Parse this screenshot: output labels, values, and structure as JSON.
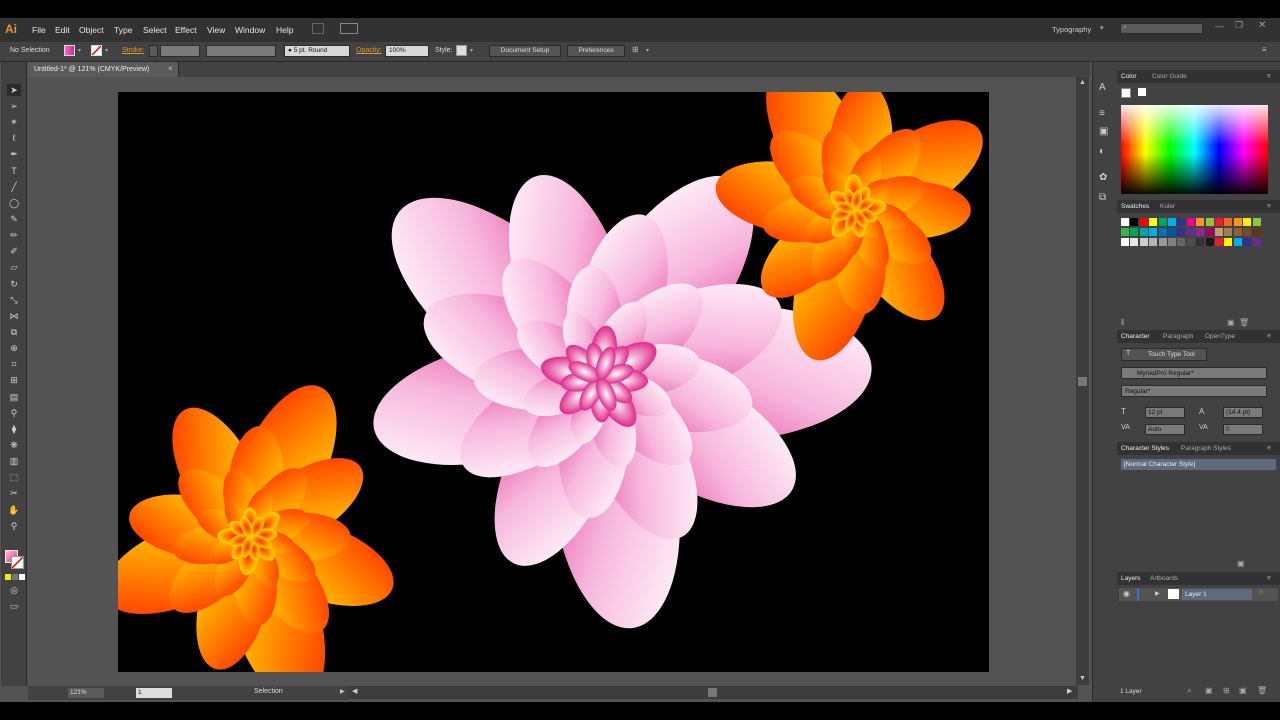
{
  "app": {
    "logo": "Ai",
    "menus": [
      "File",
      "Edit",
      "Object",
      "Type",
      "Select",
      "Effect",
      "View",
      "Window",
      "Help"
    ],
    "workspace": "Typography"
  },
  "control_bar": {
    "selection_label": "No Selection",
    "stroke_label": "Stroke:",
    "brush_value": "5 pt. Round",
    "opacity_label": "Opacity:",
    "opacity_value": "100%",
    "style_label": "Style:",
    "document_setup": "Document Setup",
    "preferences": "Preferences"
  },
  "document": {
    "tab_title": "Untitled-1* @ 121% (CMYK/Preview)",
    "close": "×"
  },
  "status": {
    "zoom": "121%",
    "page": "1",
    "mode": "Selection"
  },
  "panels": {
    "color": {
      "tabs": [
        "Color",
        "Color Guide"
      ]
    },
    "swatches": {
      "tabs": [
        "Swatches",
        "Kuler"
      ]
    },
    "character": {
      "tabs": [
        "Character",
        "Paragraph",
        "OpenType"
      ],
      "touch_type": "Touch Type Tool",
      "font": "MyriadPro Regular*",
      "style": "Regular*",
      "size": "12 pt",
      "leading": "(14.4 pt)",
      "kerning": "Auto",
      "tracking": "0"
    },
    "char_styles": {
      "tabs": [
        "Character Styles",
        "Paragraph Styles"
      ],
      "items": [
        "[Normal Character Style]"
      ]
    },
    "layers": {
      "tabs": [
        "Layers",
        "Artboards"
      ],
      "items": [
        "Layer 1"
      ],
      "footer": "1 Layer"
    }
  },
  "colors": {
    "accent": "#e5952a",
    "artboard": "#000000",
    "pink_flower": "#e8348f",
    "orange_flower": "#ff4a00",
    "yellow": "#ffe200"
  },
  "icons": [
    "selection-tool",
    "direct-selection-tool",
    "magic-wand",
    "lasso",
    "pen",
    "type",
    "line",
    "ellipse",
    "paintbrush",
    "pencil",
    "blob-brush",
    "eraser",
    "rotate",
    "scale",
    "width",
    "free-transform",
    "shape-builder",
    "perspective-grid",
    "mesh",
    "gradient",
    "eyedropper",
    "blend",
    "symbol-sprayer",
    "column-graph",
    "artboard",
    "slice",
    "hand",
    "zoom"
  ]
}
